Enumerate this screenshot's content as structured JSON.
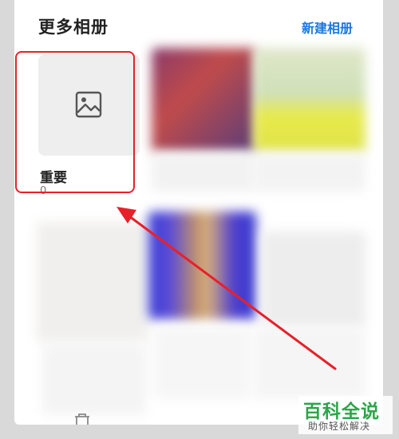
{
  "header": {
    "title": "更多相册",
    "new_album_label": "新建相册"
  },
  "album": {
    "name": "重要",
    "count": "0",
    "icon": "image-icon"
  },
  "annotation": {
    "highlight_color": "#e8202a",
    "arrow_color": "#e8202a"
  },
  "watermark": {
    "main": "百科全说",
    "sub": "助你轻松解决"
  },
  "colors": {
    "accent": "#1a78e0",
    "watermark_green": "#2aa64a"
  }
}
